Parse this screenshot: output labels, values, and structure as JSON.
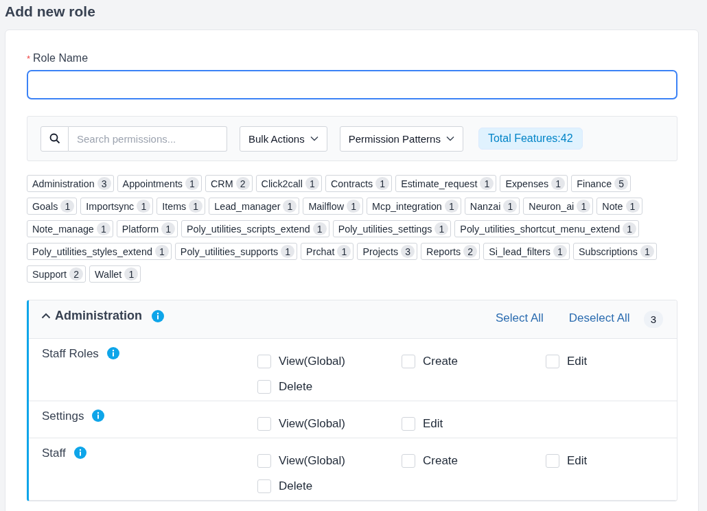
{
  "page_title": "Add new role",
  "role_name": {
    "label": "Role Name",
    "required_mark": "*"
  },
  "toolbar": {
    "search": {
      "placeholder": "Search permissions..."
    },
    "bulk_actions": "Bulk Actions",
    "permission_patterns": "Permission Patterns",
    "total_features": "Total Features:42"
  },
  "feature_tags": [
    {
      "label": "Administration",
      "count": "3"
    },
    {
      "label": "Appointments",
      "count": "1"
    },
    {
      "label": "CRM",
      "count": "2"
    },
    {
      "label": "Click2call",
      "count": "1"
    },
    {
      "label": "Contracts",
      "count": "1"
    },
    {
      "label": "Estimate_request",
      "count": "1"
    },
    {
      "label": "Expenses",
      "count": "1"
    },
    {
      "label": "Finance",
      "count": "5"
    },
    {
      "label": "Goals",
      "count": "1"
    },
    {
      "label": "Importsync",
      "count": "1"
    },
    {
      "label": "Items",
      "count": "1"
    },
    {
      "label": "Lead_manager",
      "count": "1"
    },
    {
      "label": "Mailflow",
      "count": "1"
    },
    {
      "label": "Mcp_integration",
      "count": "1"
    },
    {
      "label": "Nanzai",
      "count": "1"
    },
    {
      "label": "Neuron_ai",
      "count": "1"
    },
    {
      "label": "Note",
      "count": "1"
    },
    {
      "label": "Note_manage",
      "count": "1"
    },
    {
      "label": "Platform",
      "count": "1"
    },
    {
      "label": "Poly_utilities_scripts_extend",
      "count": "1"
    },
    {
      "label": "Poly_utilities_settings",
      "count": "1"
    },
    {
      "label": "Poly_utilities_shortcut_menu_extend",
      "count": "1"
    },
    {
      "label": "Poly_utilities_styles_extend",
      "count": "1"
    },
    {
      "label": "Poly_utilities_supports",
      "count": "1"
    },
    {
      "label": "Prchat",
      "count": "1"
    },
    {
      "label": "Projects",
      "count": "3"
    },
    {
      "label": "Reports",
      "count": "2"
    },
    {
      "label": "Si_lead_filters",
      "count": "1"
    },
    {
      "label": "Subscriptions",
      "count": "1"
    },
    {
      "label": "Support",
      "count": "2"
    },
    {
      "label": "Wallet",
      "count": "1"
    }
  ],
  "section": {
    "title": "Administration",
    "expanded": true,
    "select_all": "Select All",
    "deselect_all": "Deselect All",
    "count": "3",
    "rows": [
      {
        "name": "Staff Roles",
        "permissions": [
          {
            "label": "View(Global)",
            "checked": false
          },
          {
            "label": "Create",
            "checked": false
          },
          {
            "label": "Edit",
            "checked": false
          },
          {
            "label": "Delete",
            "checked": false
          }
        ]
      },
      {
        "name": "Settings",
        "permissions": [
          {
            "label": "View(Global)",
            "checked": false
          },
          {
            "label": "Edit",
            "checked": false
          }
        ]
      },
      {
        "name": "Staff",
        "permissions": [
          {
            "label": "View(Global)",
            "checked": false
          },
          {
            "label": "Create",
            "checked": false
          },
          {
            "label": "Edit",
            "checked": false
          },
          {
            "label": "Delete",
            "checked": false
          }
        ]
      }
    ]
  }
}
